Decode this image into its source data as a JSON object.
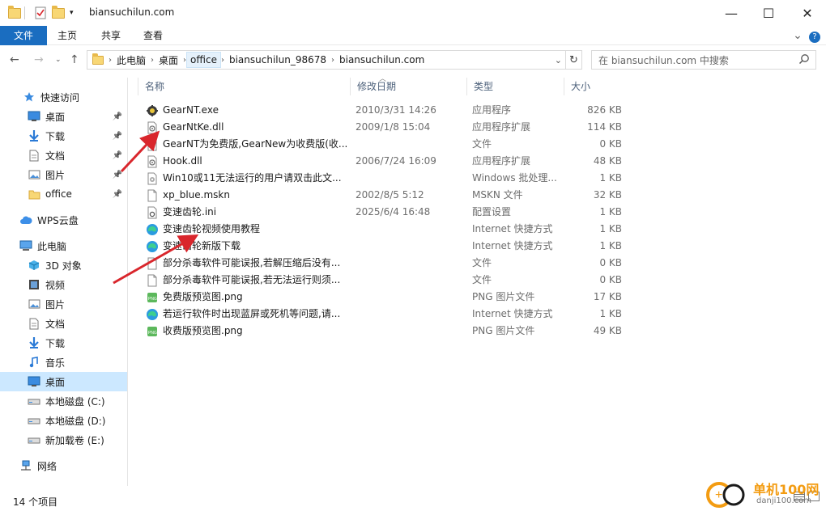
{
  "window": {
    "title": "biansuchilun.com",
    "minimize": "—",
    "maximize": "☐",
    "close": "✕"
  },
  "ribbon": {
    "tabs": [
      "文件",
      "主页",
      "共享",
      "查看"
    ],
    "collapse": "⌄",
    "help": "?"
  },
  "address": {
    "breadcrumbs": [
      "此电脑",
      "桌面",
      "office",
      "biansuchilun_98678",
      "biansuchilun.com"
    ],
    "search_placeholder": "在 biansuchilun.com 中搜索"
  },
  "sidebar": {
    "items": [
      {
        "label": "快速访问",
        "icon": "star-icon"
      },
      {
        "label": "桌面",
        "icon": "desktop-icon",
        "pinned": true
      },
      {
        "label": "下载",
        "icon": "download-icon",
        "pinned": true
      },
      {
        "label": "文档",
        "icon": "document-icon",
        "pinned": true
      },
      {
        "label": "图片",
        "icon": "picture-icon",
        "pinned": true
      },
      {
        "label": "office",
        "icon": "folder-icon",
        "pinned": true
      },
      {
        "label": "WPS云盘",
        "icon": "cloud-icon"
      },
      {
        "label": "此电脑",
        "icon": "computer-icon"
      },
      {
        "label": "3D 对象",
        "icon": "cube-icon"
      },
      {
        "label": "视频",
        "icon": "video-icon"
      },
      {
        "label": "图片",
        "icon": "picture-icon"
      },
      {
        "label": "文档",
        "icon": "document-icon"
      },
      {
        "label": "下载",
        "icon": "download-icon"
      },
      {
        "label": "音乐",
        "icon": "music-icon"
      },
      {
        "label": "桌面",
        "icon": "desktop-icon",
        "selected": true
      },
      {
        "label": "本地磁盘 (C:)",
        "icon": "drive-icon"
      },
      {
        "label": "本地磁盘 (D:)",
        "icon": "drive-icon"
      },
      {
        "label": "新加载卷 (E:)",
        "icon": "drive-icon"
      },
      {
        "label": "网络",
        "icon": "network-icon"
      }
    ]
  },
  "columns": {
    "name": "名称",
    "date": "修改日期",
    "type": "类型",
    "size": "大小"
  },
  "files": [
    {
      "name": "GearNT.exe",
      "date": "2010/3/31 14:26",
      "type": "应用程序",
      "size": "826 KB",
      "icon": "exe-icon"
    },
    {
      "name": "GearNtKe.dll",
      "date": "2009/1/8 15:04",
      "type": "应用程序扩展",
      "size": "114 KB",
      "icon": "dll-icon"
    },
    {
      "name": "GearNT为免费版,GearNew为收费版(收...",
      "date": "",
      "type": "文件",
      "size": "0 KB",
      "icon": "file-icon"
    },
    {
      "name": "Hook.dll",
      "date": "2006/7/24 16:09",
      "type": "应用程序扩展",
      "size": "48 KB",
      "icon": "dll-icon"
    },
    {
      "name": "Win10或11无法运行的用户请双击此文...",
      "date": "",
      "type": "Windows 批处理...",
      "size": "1 KB",
      "icon": "batch-icon"
    },
    {
      "name": "xp_blue.mskn",
      "date": "2002/8/5 5:12",
      "type": "MSKN 文件",
      "size": "32 KB",
      "icon": "file-icon"
    },
    {
      "name": "变速齿轮.ini",
      "date": "2025/6/4 16:48",
      "type": "配置设置",
      "size": "1 KB",
      "icon": "ini-icon"
    },
    {
      "name": "变速齿轮视频使用教程",
      "date": "",
      "type": "Internet 快捷方式",
      "size": "1 KB",
      "icon": "edge-icon"
    },
    {
      "name": "变速齿轮新版下载",
      "date": "",
      "type": "Internet 快捷方式",
      "size": "1 KB",
      "icon": "edge-icon"
    },
    {
      "name": "部分杀毒软件可能误报,若解压缩后没有...",
      "date": "",
      "type": "文件",
      "size": "0 KB",
      "icon": "file-icon"
    },
    {
      "name": "部分杀毒软件可能误报,若无法运行则须...",
      "date": "",
      "type": "文件",
      "size": "0 KB",
      "icon": "file-icon"
    },
    {
      "name": "免费版预览图.png",
      "date": "",
      "type": "PNG 图片文件",
      "size": "17 KB",
      "icon": "png-icon"
    },
    {
      "name": "若运行软件时出现蓝屏或死机等问题,请...",
      "date": "",
      "type": "Internet 快捷方式",
      "size": "1 KB",
      "icon": "edge-icon"
    },
    {
      "name": "收费版预览图.png",
      "date": "",
      "type": "PNG 图片文件",
      "size": "49 KB",
      "icon": "png-icon"
    }
  ],
  "status": {
    "count": "14 个项目"
  },
  "watermark": {
    "text_top": "单机100网",
    "text_bottom": "danji100.com"
  },
  "colors": {
    "accent": "#1a6dc0",
    "selected_bg": "#cce8ff",
    "annotation_arrow": "#d9262c"
  }
}
